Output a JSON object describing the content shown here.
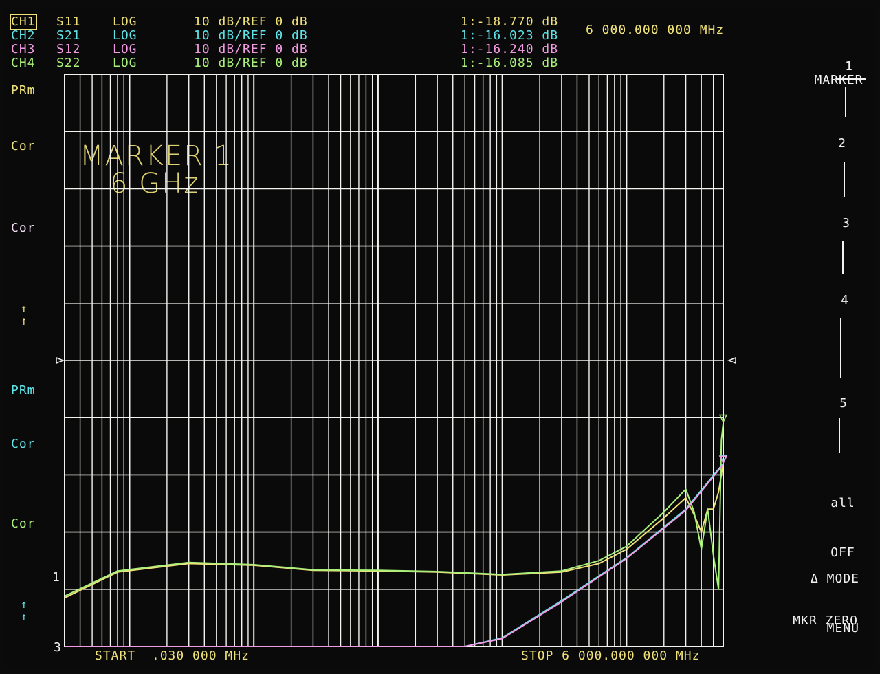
{
  "channels": [
    {
      "id": "CH1",
      "param": "S11",
      "format": "LOG",
      "scale": "10 dB/REF 0 dB",
      "marker": "1:-18.770 dB",
      "active": true,
      "color": "#f0e27a"
    },
    {
      "id": "CH2",
      "param": "S21",
      "format": "LOG",
      "scale": "10 dB/REF 0 dB",
      "marker": "1:-16.023 dB",
      "active": false,
      "color": "#5fe3e6"
    },
    {
      "id": "CH3",
      "param": "S12",
      "format": "LOG",
      "scale": "10 dB/REF 0 dB",
      "marker": "1:-16.240 dB",
      "active": false,
      "color": "#f29be4"
    },
    {
      "id": "CH4",
      "param": "S22",
      "format": "LOG",
      "scale": "10 dB/REF 0 dB",
      "marker": "1:-16.085 dB",
      "active": false,
      "color": "#a9f07a"
    }
  ],
  "marker_freq": "6 000.000 000 MHz",
  "annotation": {
    "line1": "MARKER 1",
    "line2": "6 GHz"
  },
  "left_labels": {
    "prm_top": "PRm",
    "cor_1": "Cor",
    "cor_2": "Cor",
    "arrows_1": "↑\n↑",
    "prm_mid": "PRm",
    "cor_3": "Cor",
    "cor_4": "Cor",
    "num_1": "1",
    "arrows_2": "↑\n↑",
    "num_3": "3"
  },
  "bottom": {
    "start": "START  .030 000 MHz",
    "stop": "STOP 6 000.000 000 MHz"
  },
  "softkeys": {
    "title": "MARKER",
    "k1": "1",
    "k2": "2",
    "k3": "3",
    "k4": "4",
    "k5": "5",
    "all_off_1": "all",
    "all_off_2": "OFF",
    "mode_menu_1": "Δ MODE",
    "mode_menu_2": "MENU",
    "mkr_zero": "MKR ZERO"
  },
  "chart_data": {
    "type": "line",
    "x_scale": "log",
    "x_range_mhz": [
      0.03,
      6000
    ],
    "ylim_db": [
      -100,
      0
    ],
    "y_divisions": 10,
    "series": [
      {
        "name": "S11",
        "color": "#f0e27a",
        "x": [
          0.03,
          0.08,
          0.3,
          1,
          3,
          10,
          30,
          100,
          300,
          600,
          1000,
          2000,
          3000,
          3500,
          4000,
          4500,
          5000,
          5500,
          6000
        ],
        "y": [
          -91.5,
          -87,
          -85.5,
          -85.8,
          -86.7,
          -86.8,
          -87,
          -87.5,
          -87,
          -85.5,
          -83,
          -77.5,
          -74,
          -77,
          -80,
          -76,
          -76,
          -73,
          -68
        ]
      },
      {
        "name": "S22",
        "color": "#a9f07a",
        "x": [
          0.03,
          0.08,
          0.3,
          1,
          3,
          10,
          30,
          100,
          300,
          600,
          1000,
          2000,
          3000,
          3500,
          4000,
          4500,
          5000,
          5500,
          5800,
          6000
        ],
        "y": [
          -91.2,
          -86.8,
          -85.3,
          -85.7,
          -86.6,
          -86.7,
          -86.9,
          -87.4,
          -86.8,
          -85,
          -82.5,
          -76.5,
          -72.5,
          -76.5,
          -83,
          -76,
          -84,
          -90,
          -64,
          -61
        ]
      },
      {
        "name": "S21",
        "color": "#5fe3e6",
        "x": [
          0.03,
          50,
          100,
          300,
          1000,
          3000,
          6000
        ],
        "y": [
          -100,
          -100,
          -98.5,
          -92,
          -84.5,
          -76,
          -68
        ]
      },
      {
        "name": "S12",
        "color": "#f29be4",
        "x": [
          0.03,
          50,
          100,
          300,
          1000,
          3000,
          6000
        ],
        "y": [
          -100,
          -100,
          -98.6,
          -92.2,
          -84.6,
          -76.2,
          -68.2
        ]
      }
    ]
  }
}
